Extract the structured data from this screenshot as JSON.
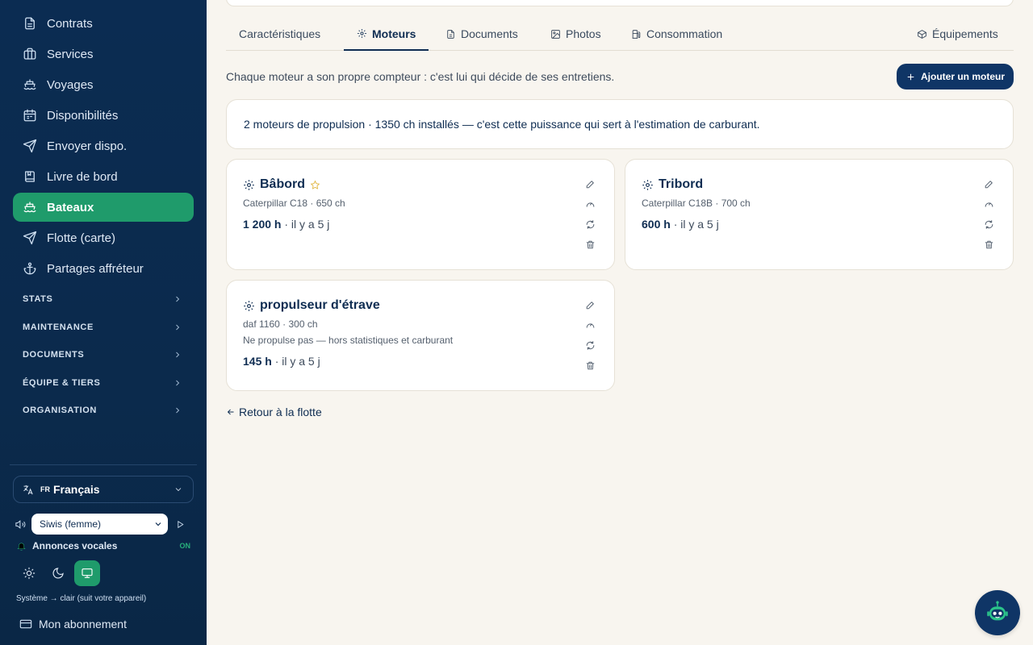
{
  "sidebar": {
    "items": [
      {
        "label": "Contrats",
        "icon": "document-icon"
      },
      {
        "label": "Services",
        "icon": "briefcase-icon"
      },
      {
        "label": "Voyages",
        "icon": "ship-icon"
      },
      {
        "label": "Disponibilités",
        "icon": "calendar-icon"
      },
      {
        "label": "Envoyer dispo.",
        "icon": "send-icon"
      },
      {
        "label": "Livre de bord",
        "icon": "book-icon"
      },
      {
        "label": "Bateaux",
        "icon": "ship-icon",
        "active": true
      },
      {
        "label": "Flotte (carte)",
        "icon": "navigation-icon"
      },
      {
        "label": "Partages affréteur",
        "icon": "anchor-icon"
      }
    ],
    "groups": [
      "STATS",
      "MAINTENANCE",
      "DOCUMENTS",
      "ÉQUIPE & TIERS",
      "ORGANISATION"
    ],
    "language": {
      "code": "FR",
      "name": "Français"
    },
    "voice": {
      "selected": "Siwis (femme)"
    },
    "announcements": {
      "label": "Annonces vocales",
      "state": "ON"
    },
    "theme_note": "Système → clair (suit votre appareil)",
    "subscription": "Mon abonnement"
  },
  "tabs": [
    {
      "label": "Caractéristiques",
      "icon": ""
    },
    {
      "label": "Moteurs",
      "icon": "gear-icon",
      "active": true
    },
    {
      "label": "Documents",
      "icon": "document-icon"
    },
    {
      "label": "Photos",
      "icon": "image-icon"
    },
    {
      "label": "Consommation",
      "icon": "fuel-icon"
    },
    {
      "label": "Équipements",
      "icon": "box-icon"
    }
  ],
  "main": {
    "intro": "Chaque moteur a son propre compteur : c'est lui qui décide de ses entretiens.",
    "add_button": "Ajouter un moteur",
    "summary": "2 moteurs de propulsion · 1350 ch installés — c'est cette puissance qui sert à l'estimation de carburant.",
    "back_link": "Retour à la flotte"
  },
  "engines": [
    {
      "name": "Bâbord",
      "spec": "Caterpillar C18 · 650 ch",
      "hours": "1 200 h",
      "ago": " · il y a 5 j",
      "starred": true,
      "note": ""
    },
    {
      "name": "Tribord",
      "spec": "Caterpillar C18B · 700 ch",
      "hours": "600 h",
      "ago": " · il y a 5 j",
      "starred": false,
      "note": ""
    },
    {
      "name": "propulseur d'étrave",
      "spec": "daf 1160 · 300 ch",
      "hours": "145 h",
      "ago": " · il y a 5 j",
      "starred": false,
      "note": "Ne propulse pas — hors statistiques et carburant"
    }
  ],
  "colors": {
    "sidebar": "#0b2c52",
    "accent": "#1f9b6b",
    "primary": "#0f3566",
    "background": "#f8f5ef"
  }
}
